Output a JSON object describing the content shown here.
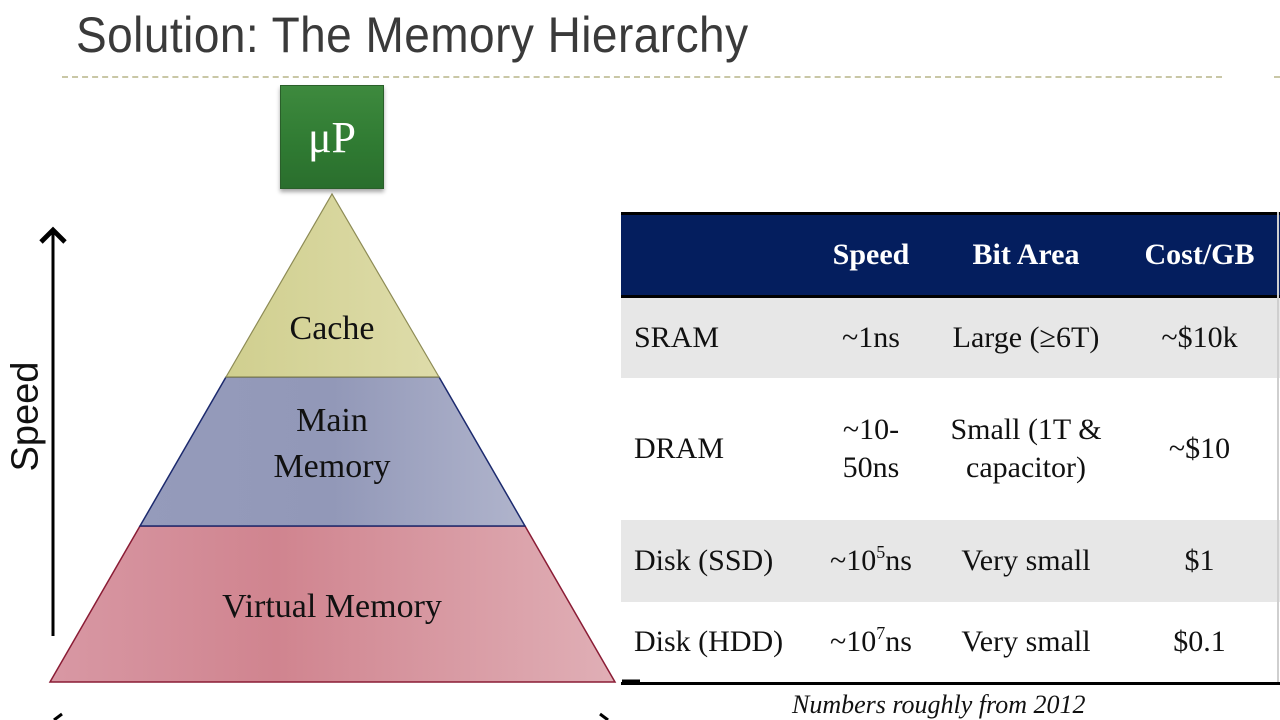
{
  "slide": {
    "title": "Solution: The Memory Hierarchy"
  },
  "diagram": {
    "processor_label": "μP",
    "axis_label": "Speed",
    "layers": [
      {
        "label_lines": [
          "Cache"
        ],
        "color": "#d8d79c"
      },
      {
        "label_lines": [
          "Main",
          "Memory"
        ],
        "color": "#9ba1c0"
      },
      {
        "label_lines": [
          "Virtual Memory"
        ],
        "color": "#d48b98"
      }
    ],
    "accent_colors": {
      "processor": "#2f7a32",
      "table_header": "#041e5e",
      "row_shade": "#e7e7e7",
      "title_rule": "#c9c7a6"
    }
  },
  "table": {
    "headers": [
      "",
      "Speed",
      "Bit Area",
      "Cost/GB"
    ],
    "rows": [
      {
        "name": "SRAM",
        "speed": "~1ns",
        "speed_exp": "",
        "speed_unit": "",
        "area_lines": [
          "Large (≥6T)"
        ],
        "cost": "~$10k"
      },
      {
        "name": "DRAM",
        "speed_lines": [
          "~10-",
          "50ns"
        ],
        "area_lines": [
          "Small (1T &",
          "capacitor)"
        ],
        "cost": "~$10"
      },
      {
        "name": "Disk (SSD)",
        "speed": "~10",
        "speed_exp": "5",
        "speed_unit": "ns",
        "area_lines": [
          "Very small"
        ],
        "cost": "$1"
      },
      {
        "name": "Disk (HDD)",
        "speed": "~10",
        "speed_exp": "7",
        "speed_unit": "ns",
        "area_lines": [
          "Very small"
        ],
        "cost": "$0.1"
      }
    ],
    "footnote": "Numbers roughly from 2012"
  }
}
